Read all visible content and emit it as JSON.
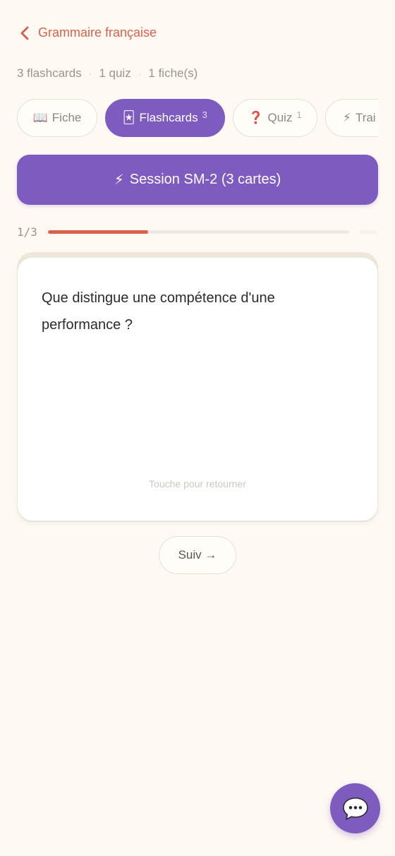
{
  "header": {
    "back_label": "Grammaire française",
    "back_icon": "chevron-left-icon"
  },
  "stats": {
    "flashcards": "3 flashcards",
    "quiz": "1 quiz",
    "fiches": "1 fiche(s)",
    "separator": "·"
  },
  "tabs": [
    {
      "icon": "📖",
      "label": "Fiche",
      "count": "",
      "active": false
    },
    {
      "icon": "🃏",
      "label": "Flashcards",
      "count": "3",
      "active": true
    },
    {
      "icon": "❓",
      "label": "Quiz",
      "count": "1",
      "active": false
    },
    {
      "icon": "⚡",
      "label": "Trai",
      "count": "",
      "active": false
    }
  ],
  "session": {
    "icon": "⚡",
    "label": "Session SM-2 (3 cartes)"
  },
  "progress": {
    "label": "1/3",
    "fraction": 0.3333
  },
  "card": {
    "question": "Que distingue une compétence d'une performance ?",
    "hint": "Touche pour retourner"
  },
  "navigation": {
    "next_label": "Suiv →"
  },
  "colors": {
    "accent_purple": "#7e5bbf",
    "accent_red": "#d9614b",
    "background": "#fefaf3"
  }
}
